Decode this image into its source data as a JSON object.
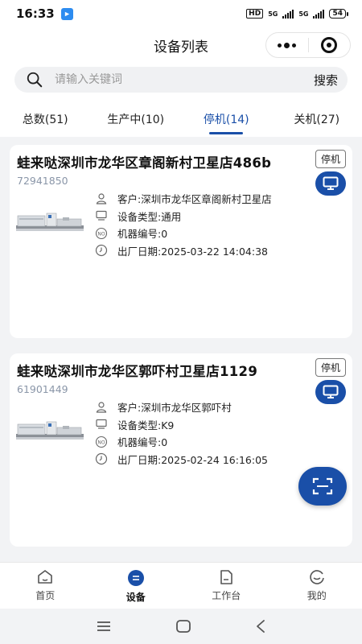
{
  "status_bar": {
    "time": "16:33",
    "hd": "HD",
    "net1": "5G",
    "net2": "5G",
    "battery": "54"
  },
  "header": {
    "title": "设备列表"
  },
  "search": {
    "placeholder": "请输入关键词",
    "button": "搜索"
  },
  "tabs": [
    {
      "label": "总数(51)"
    },
    {
      "label": "生产中(10)"
    },
    {
      "label": "停机(14)"
    },
    {
      "label": "关机(27)"
    }
  ],
  "devices": [
    {
      "name": "蛙来哒深圳市龙华区章阁新村卫星店486b",
      "code": "72941850",
      "status": "停机",
      "customer": "客户:深圳市龙华区章阁新村卫星店",
      "type": "设备类型:通用",
      "machine_no": "机器编号:0",
      "date": "出厂日期:2025-03-22 14:04:38"
    },
    {
      "name": "蛙来哒深圳市龙华区郭吓村卫星店1129",
      "code": "61901449",
      "status": "停机",
      "customer": "客户:深圳市龙华区郭吓村",
      "type": "设备类型:K9",
      "machine_no": "机器编号:0",
      "date": "出厂日期:2025-02-24 16:16:05"
    }
  ],
  "bottom_nav": [
    {
      "label": "首页"
    },
    {
      "label": "设备"
    },
    {
      "label": "工作台"
    },
    {
      "label": "我的"
    }
  ],
  "colors": {
    "accent": "#1a4fa8",
    "background": "#f2f3f5"
  },
  "icons": {
    "tab_home": "home-icon",
    "tab_device": "device-icon",
    "tab_workbench": "workbench-icon",
    "tab_me": "profile-icon"
  }
}
